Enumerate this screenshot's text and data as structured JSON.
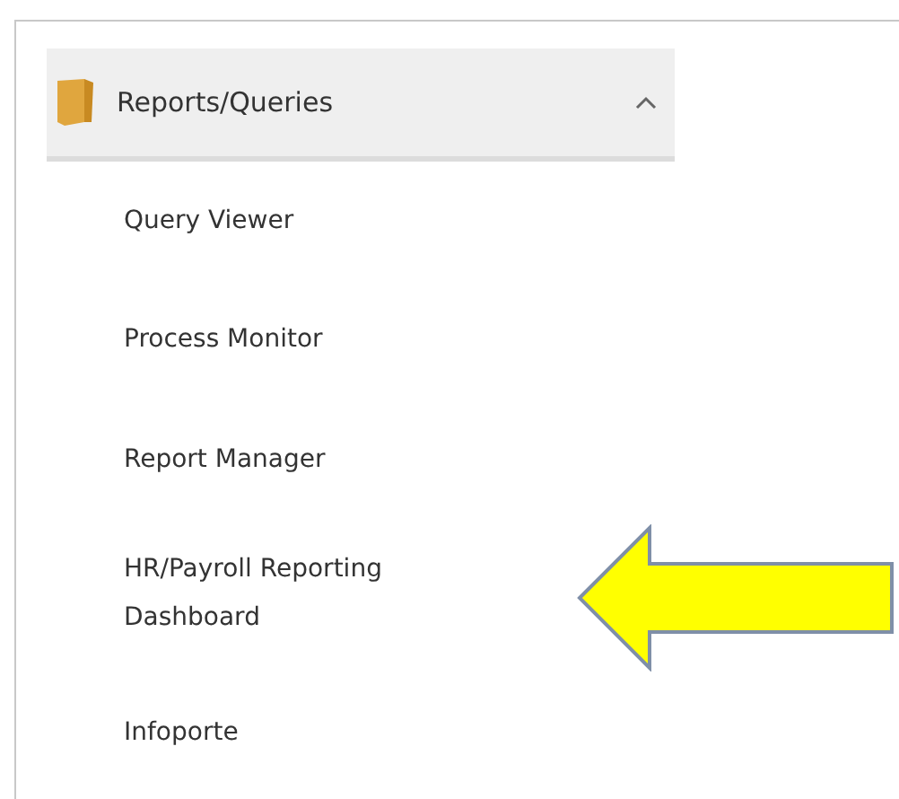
{
  "section": {
    "title": "Reports/Queries",
    "expanded": true
  },
  "items": [
    {
      "label": "Query Viewer"
    },
    {
      "label": "Process Monitor"
    },
    {
      "label": "Report Manager"
    },
    {
      "label": "HR/Payroll Reporting Dashboard"
    },
    {
      "label": "Infoporte"
    }
  ]
}
